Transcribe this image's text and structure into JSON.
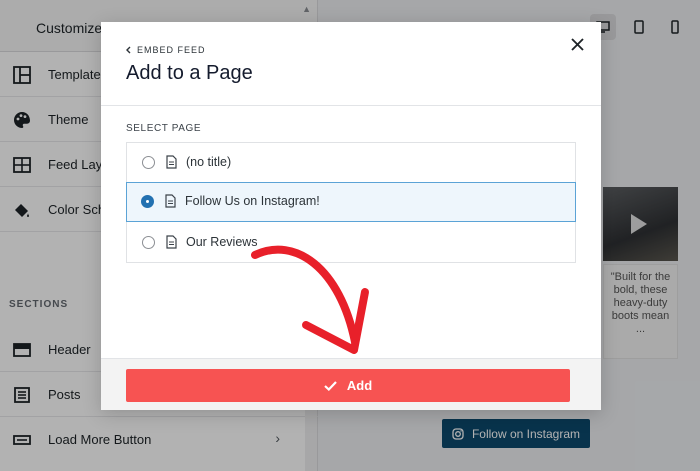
{
  "sidebar": {
    "title": "Customize",
    "items": [
      {
        "label": "Template",
        "icon": "template-icon"
      },
      {
        "label": "Theme",
        "icon": "palette-icon"
      },
      {
        "label": "Feed Layo",
        "icon": "feed-layout-icon"
      },
      {
        "label": "Color Sch",
        "icon": "paint-bucket-icon"
      }
    ],
    "section_label": "SECTIONS",
    "section_items": [
      {
        "label": "Header",
        "icon": "header-icon"
      },
      {
        "label": "Posts",
        "icon": "posts-icon"
      },
      {
        "label": "Load More Button",
        "icon": "load-more-icon"
      }
    ]
  },
  "preview": {
    "caption": "\"Built for the bold, these heavy-duty boots mean ...",
    "follow_label": "Follow on Instagram"
  },
  "modal": {
    "back_label": "EMBED FEED",
    "title": "Add to a Page",
    "select_label": "SELECT PAGE",
    "pages": [
      {
        "name": "(no title)",
        "selected": false
      },
      {
        "name": "Follow Us on Instagram!",
        "selected": true
      },
      {
        "name": "Our Reviews",
        "selected": false
      }
    ],
    "add_label": "Add"
  },
  "colors": {
    "add_button": "#f75352",
    "selected_radio": "#2271b1",
    "annotation_arrow": "#e8202a",
    "follow_button": "#0c4a6e"
  }
}
